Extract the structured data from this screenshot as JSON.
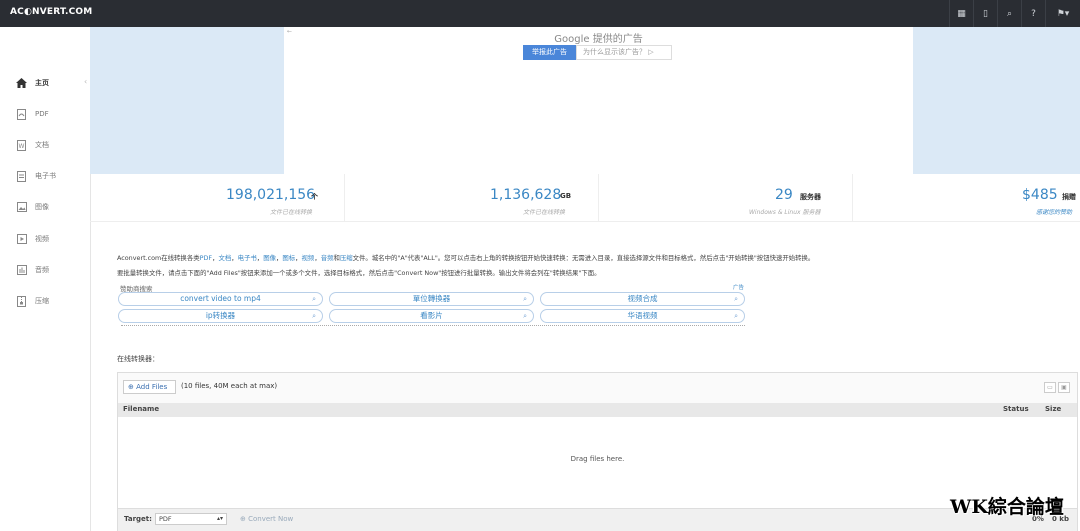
{
  "app": {
    "logo": "AC◐NVERT.COM"
  },
  "top_icons": [
    "grid-icon",
    "tablet-icon",
    "search-icon",
    "help-icon",
    "language-icon"
  ],
  "sidebar": {
    "items": [
      {
        "label": "主页",
        "icon": "home-icon"
      },
      {
        "label": "PDF",
        "icon": "pdf-icon"
      },
      {
        "label": "文档",
        "icon": "document-icon"
      },
      {
        "label": "电子书",
        "icon": "ebook-icon"
      },
      {
        "label": "图像",
        "icon": "image-icon"
      },
      {
        "label": "视频",
        "icon": "video-icon"
      },
      {
        "label": "音频",
        "icon": "audio-icon"
      },
      {
        "label": "压缩",
        "icon": "archive-icon"
      }
    ]
  },
  "ad": {
    "title": "Google 提供的广告",
    "report_button": "举报此广告",
    "why_button": "为什么显示该广告？ ▷"
  },
  "stats": [
    {
      "value": "198,021,156",
      "unit": "个",
      "caption": "文件已在线转换"
    },
    {
      "value": "1,136,628",
      "unit": "GB",
      "caption": "文件已在线转换"
    },
    {
      "value": "29",
      "unit": "服务器",
      "caption": "Windows & Linux 服务器"
    },
    {
      "value": "$485",
      "unit": "捐赠",
      "caption": "感谢您的赞助"
    }
  ],
  "intro": {
    "line1_pre": "Aconvert.com在线转换各类",
    "links": [
      "PDF",
      "文档",
      "电子书",
      "图像",
      "图标",
      "视频",
      "音频",
      "压缩"
    ],
    "line1_post": "文件。城名中的\"A\"代表\"ALL\"。您可以点击右上角的转换按钮开始快速转换：无需进入目录，直接选择源文件和目标格式，然后点击\"开始转换\"按钮快速开始转换。",
    "line2": "要批量转换文件，请点击下面的\"Add Files\"按钮来添加一个或多个文件，选择目标格式，然后点击\"Convert Now\"按钮进行批量转换。输出文件将会列在\"转换结果\"下面。"
  },
  "sponsor": {
    "label": "赞助商搜索",
    "ad_label": "广告",
    "pills": [
      "convert video to mp4",
      "單位轉換器",
      "视频合成",
      "ip转换器",
      "看影片",
      "华语视频"
    ]
  },
  "converter": {
    "title": "在线转换器：",
    "add_files": "Add Files",
    "files_note": "(10 files, 40M each at max)",
    "columns": {
      "filename": "Filename",
      "status": "Status",
      "size": "Size"
    },
    "drop_text": "Drag files here.",
    "target_label": "Target:",
    "target_value": "PDF",
    "convert_now": "Convert Now",
    "progress": "0%",
    "size_total": "0 kb"
  },
  "watermark": "WK綜合論壇"
}
